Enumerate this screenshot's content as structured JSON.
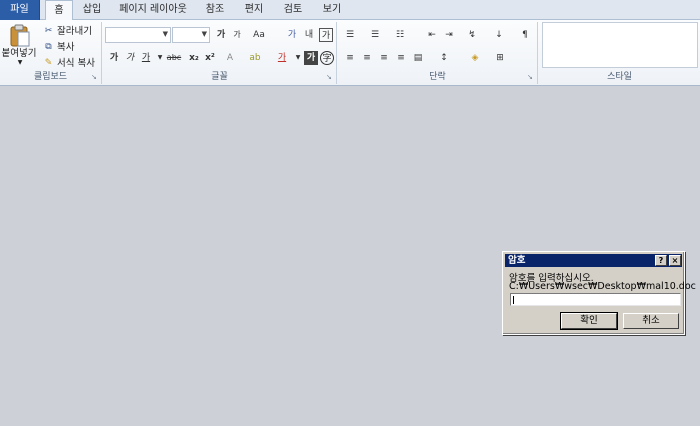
{
  "tabs": [
    {
      "label": "파일"
    },
    {
      "label": "홈"
    },
    {
      "label": "삽입"
    },
    {
      "label": "페이지 레이아웃"
    },
    {
      "label": "참조"
    },
    {
      "label": "편지"
    },
    {
      "label": "검토"
    },
    {
      "label": "보기"
    }
  ],
  "clipboard": {
    "paste_label": "붙여넣기",
    "cut_label": "잘라내기",
    "copy_label": "복사",
    "format_painter_label": "서식 복사",
    "group_label": "클립보드"
  },
  "font": {
    "font_name_value": "",
    "font_size_value": "",
    "group_label": "글꼴",
    "bold_glyph": "가",
    "italic_glyph": "가",
    "underline_glyph": "가",
    "strike_glyph": "abc",
    "case_glyph": "Aa",
    "grow_glyph": "가",
    "shrink_glyph": "가",
    "clear_glyph": "가",
    "phonetic_glyph": "내",
    "border_glyph": "가"
  },
  "paragraph": {
    "group_label": "단락"
  },
  "styles": {
    "group_label": "스타일"
  },
  "dialog": {
    "title": "암호",
    "help_glyph": "?",
    "close_glyph": "×",
    "prompt": "암호를 입력하십시오.",
    "path": "C:₩Users₩wsec₩Desktop₩mal10.doc",
    "password_value": "",
    "ok_label": "확인",
    "cancel_label": "취소"
  },
  "colors": {
    "file_tab": "#2c5ea8",
    "dialog_title": "#0a246a",
    "background": "#cdd1d7"
  }
}
